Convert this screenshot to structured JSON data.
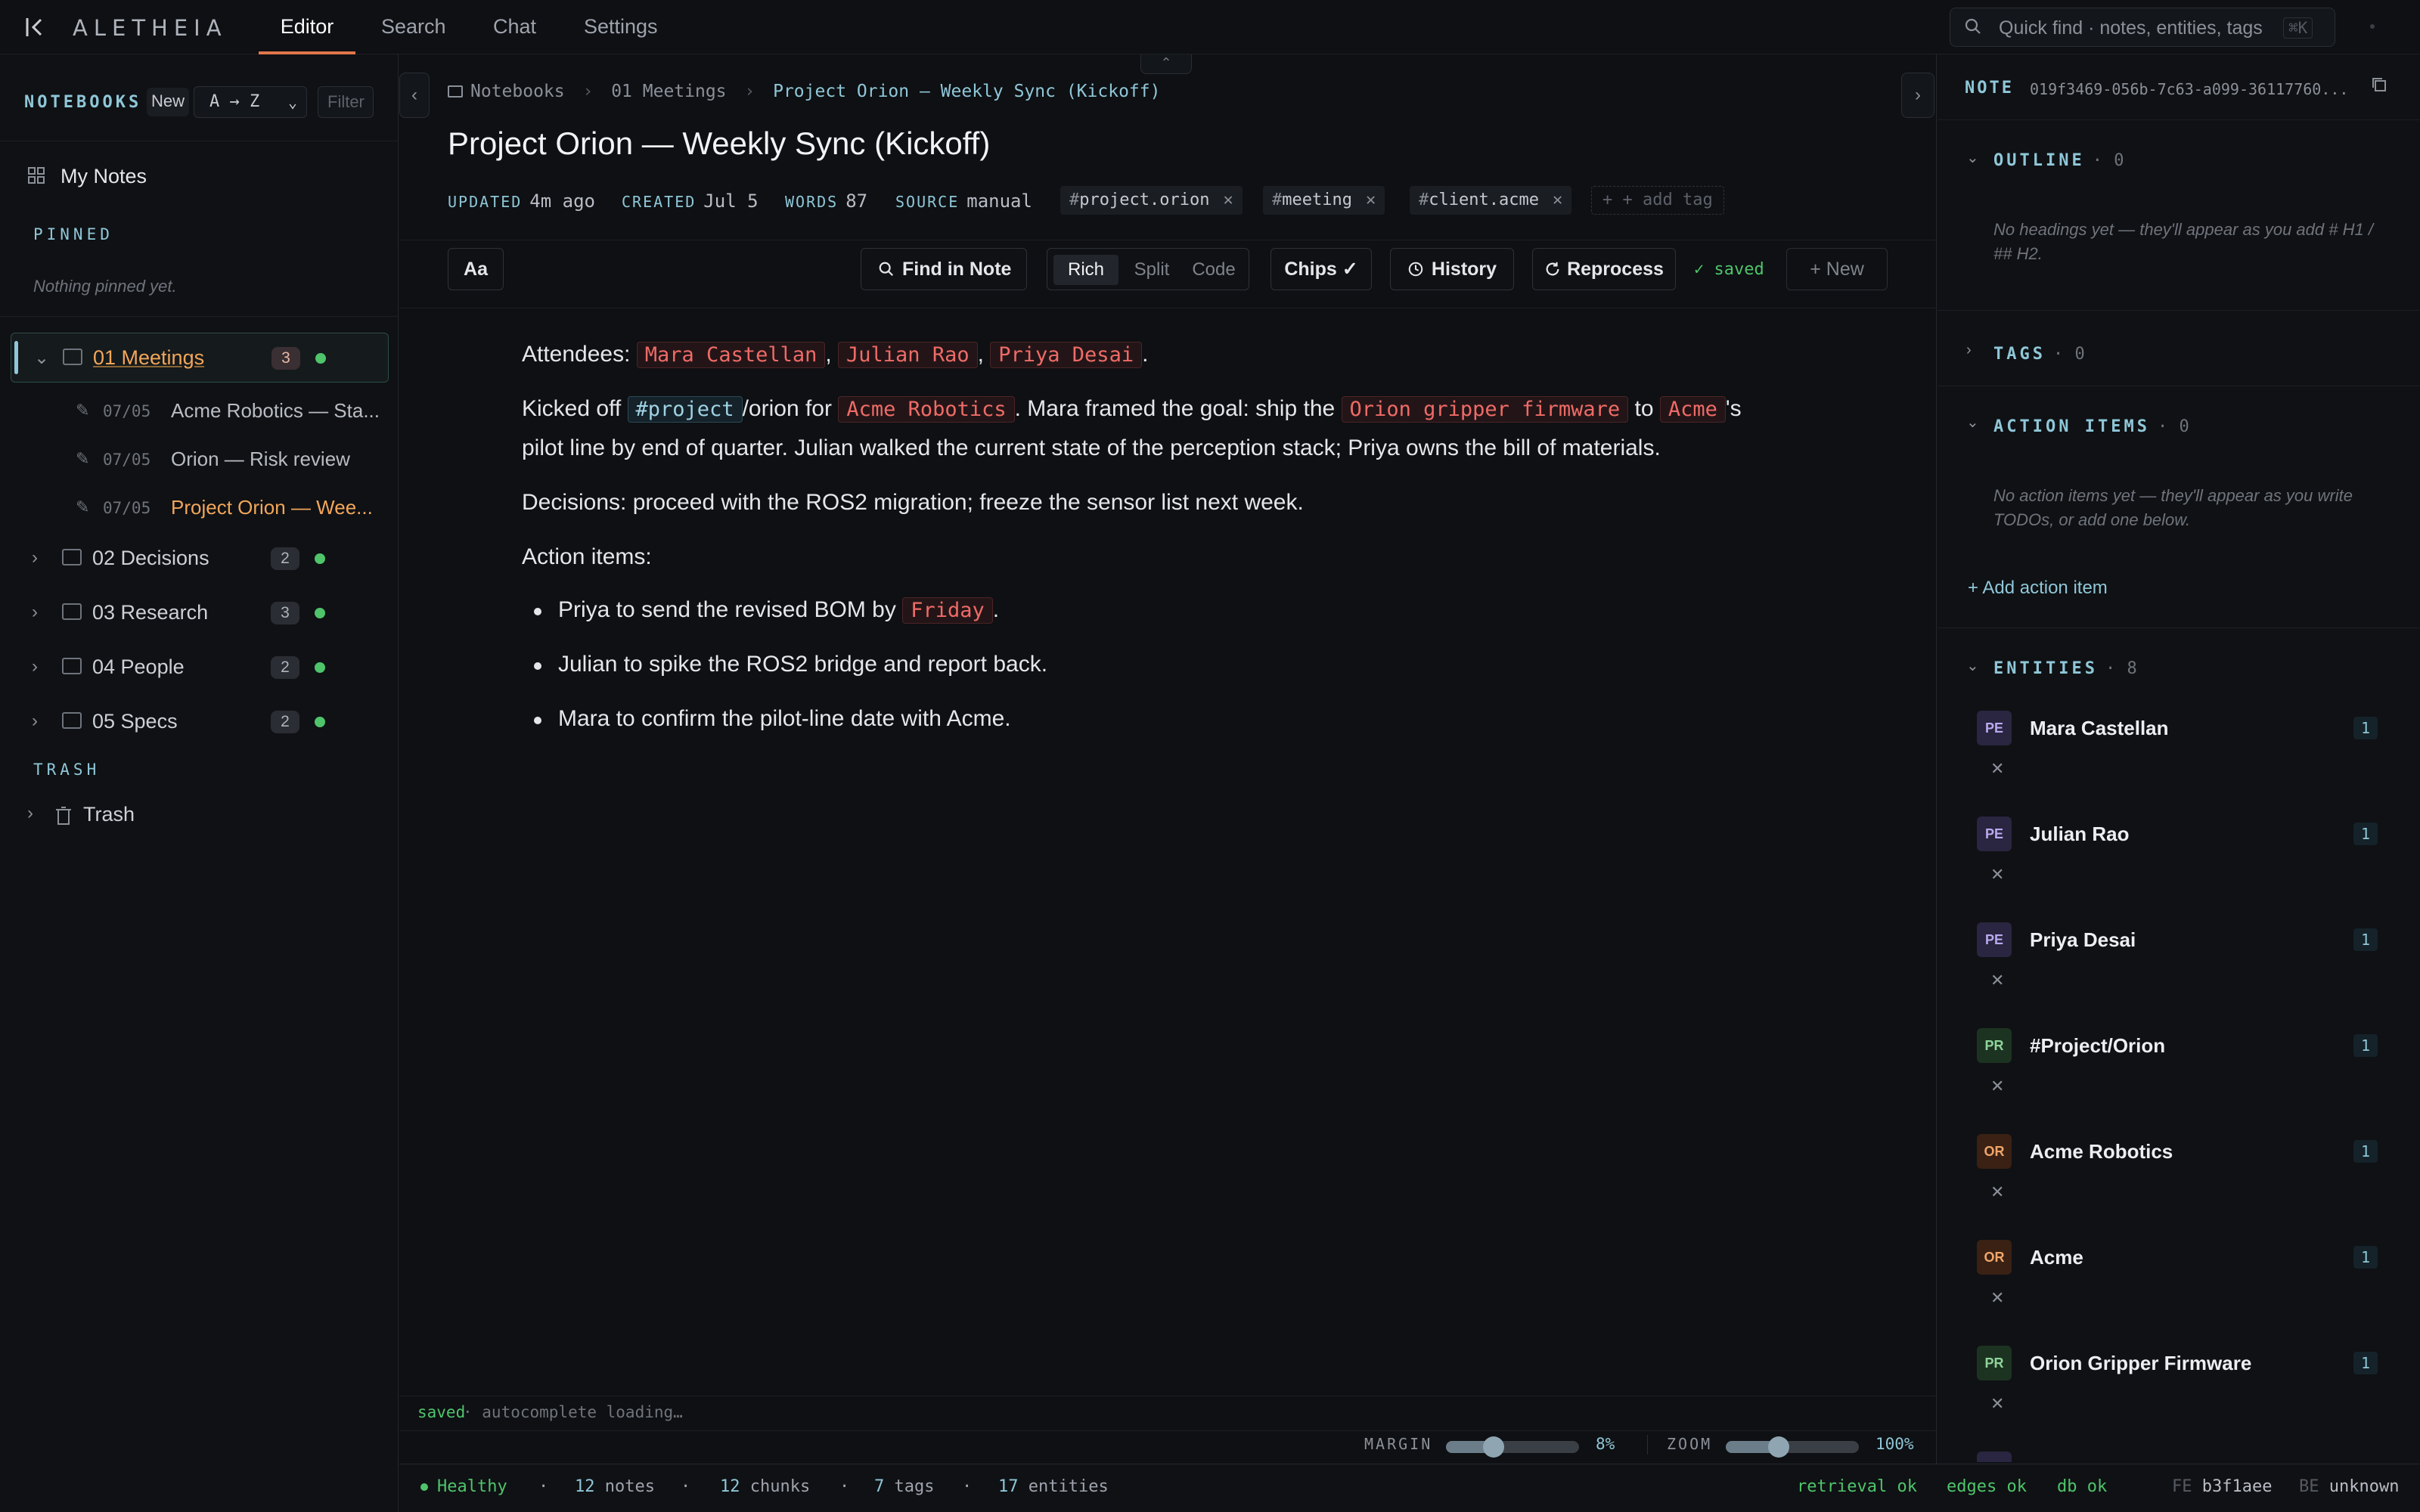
{
  "app": {
    "logo": "ALETHEIA",
    "tabs": [
      "Editor",
      "Search",
      "Chat",
      "Settings"
    ],
    "active_tab": "Editor",
    "quick_find_placeholder": "Quick find · notes, entities, tags",
    "quick_find_kbd": "⌘K"
  },
  "sidebar": {
    "title": "NOTEBOOKS",
    "new_label": "New",
    "sort": "A → Z",
    "filter_placeholder": "Filter",
    "my_notes": "My Notes",
    "pinned_label": "PINNED",
    "pinned_empty": "Nothing pinned yet.",
    "folders": [
      {
        "name": "01 Meetings",
        "count": "3"
      },
      {
        "name": "02 Decisions",
        "count": "2"
      },
      {
        "name": "03 Research",
        "count": "3"
      },
      {
        "name": "04 People",
        "count": "2"
      },
      {
        "name": "05 Specs",
        "count": "2"
      }
    ],
    "notes": [
      {
        "date": "07/05",
        "title": "Acme Robotics — Sta..."
      },
      {
        "date": "07/05",
        "title": "Orion — Risk review"
      },
      {
        "date": "07/05",
        "title": "Project Orion — Wee..."
      }
    ],
    "trash_label": "TRASH",
    "trash": "Trash"
  },
  "note": {
    "breadcrumb": [
      "Notebooks",
      "01 Meetings",
      "Project Orion — Weekly Sync (Kickoff)"
    ],
    "title": "Project Orion — Weekly Sync (Kickoff)",
    "meta": {
      "updated_k": "UPDATED",
      "updated": "4m ago",
      "created_k": "CREATED",
      "created": "Jul 5",
      "words_k": "WORDS",
      "words": "87",
      "source_k": "SOURCE",
      "source": "manual"
    },
    "tags": [
      "project.orion",
      "meeting",
      "client.acme"
    ],
    "add_tag": "+ + add tag"
  },
  "toolbar": {
    "font": "Aa",
    "find": "Find in Note",
    "modes": [
      "Rich",
      "Split",
      "Code"
    ],
    "active_mode": "Rich",
    "chips": "Chips ✓",
    "history": "History",
    "reprocess": "Reprocess",
    "saved": "✓ saved",
    "new": "+ New"
  },
  "body": {
    "p1_lead": "Attendees: ",
    "attendees": [
      "Mara Castellan",
      "Julian Rao",
      "Priya Desai"
    ],
    "p2": {
      "a": "Kicked off ",
      "tag": "#project",
      "b": "/orion for ",
      "c1": "Acme Robotics",
      "d": ". Mara framed the goal: ship the ",
      "c2": "Orion gripper firmware",
      "e": " to ",
      "c3": "Acme",
      "f": "'s"
    },
    "p2_line2": "pilot line by end of quarter. Julian walked the current state of the perception stack; Priya owns the bill of materials.",
    "p3": "Decisions: proceed with the ROS2 migration; freeze the sensor list next week.",
    "p4": "Action items:",
    "b1_a": "Priya to send the revised BOM by ",
    "b1_chip": "Friday",
    "b1_b": ".",
    "b2": "Julian to spike the ROS2 bridge and report back.",
    "b3": "Mara to confirm the pilot-line date with Acme."
  },
  "editor_status": {
    "saved": "saved",
    "autocomplete": "· autocomplete loading…",
    "margin_label": "MARGIN",
    "margin_value": "8%",
    "margin_level": 0.36,
    "zoom_label": "ZOOM",
    "zoom_value": "100%",
    "zoom_level": 0.4
  },
  "footer": {
    "health": "Healthy",
    "notes_n": "12",
    "notes_l": "notes",
    "chunks_n": "12",
    "chunks_l": "chunks",
    "tags_n": "7",
    "tags_l": "tags",
    "entities_n": "17",
    "entities_l": "entities",
    "retrieval": "retrieval ok",
    "edges": "edges ok",
    "db": "db ok",
    "fe_k": "FE",
    "fe": "b3f1aee",
    "be_k": "BE",
    "be": "unknown"
  },
  "panel": {
    "note_k": "NOTE",
    "note_id": "019f3469-056b-7c63-a099-36117760...",
    "outline": "OUTLINE",
    "outline_count": "· 0",
    "outline_empty": "No headings yet — they'll appear as you add # H1 / ## H2.",
    "tags": "TAGS",
    "tags_count": "· 0",
    "actions": "ACTION ITEMS",
    "actions_count": "· 0",
    "actions_empty": "No action items yet — they'll appear as you write TODOs, or add one below.",
    "add_action": "+ Add action item",
    "entities": "ENTITIES",
    "entities_count": "· 8",
    "entity_list": [
      {
        "type": "PE",
        "name": "Mara Castellan",
        "count": "1"
      },
      {
        "type": "PE",
        "name": "Julian Rao",
        "count": "1"
      },
      {
        "type": "PE",
        "name": "Priya Desai",
        "count": "1"
      },
      {
        "type": "PR",
        "name": "#Project/Orion",
        "count": "1"
      },
      {
        "type": "OR",
        "name": "Acme Robotics",
        "count": "1"
      },
      {
        "type": "OR",
        "name": "Acme",
        "count": "1"
      },
      {
        "type": "PR",
        "name": "Orion Gripper Firmware",
        "count": "1"
      }
    ]
  }
}
